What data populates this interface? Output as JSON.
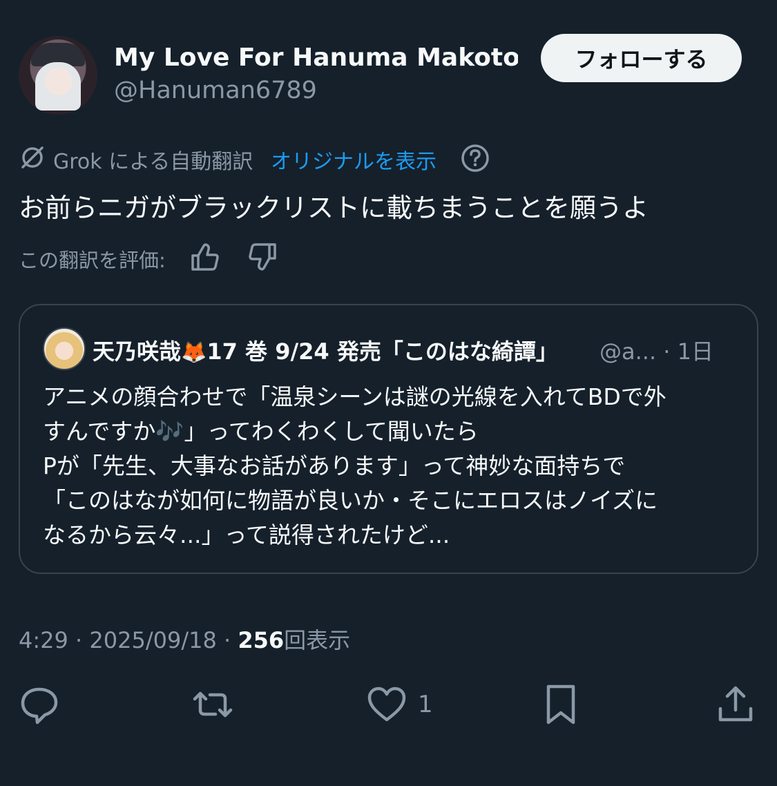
{
  "author": {
    "display_name": "My Love For Hanuma Makoto...",
    "handle": "@Hanuman6789",
    "follow_label": "フォローする"
  },
  "translation": {
    "grok_label": "Grok による自動翻訳",
    "show_original": "オリジナルを表示",
    "rate_label": "この翻訳を評価:"
  },
  "tweet": {
    "text": "お前らニガがブラックリストに載ちまうことを願うよ"
  },
  "quote": {
    "name": "天乃咲哉",
    "name_emoji": "🦊",
    "name_suffix": "17 巻 9/24 発売「このはな綺譚」",
    "meta": "@a... · 1日",
    "lines": [
      "アニメの顔合わせで「温泉シーンは謎の光線を入れてBDで外",
      "すんですか🎶」ってわくわくして聞いたら",
      "Pが「先生、大事なお話があります」って神妙な面持ちで",
      "「このはなが如何に物語が良いか・そこにエロスはノイズに",
      "なるから云々...」って説得されたけど..."
    ]
  },
  "timestamp": {
    "time_date": "4:29 · 2025/09/18 · ",
    "views_count": "256",
    "views_label": "回表示"
  },
  "actions": {
    "like_count": "1"
  },
  "colors": {
    "background": "#15202b",
    "text": "#f7f9f9",
    "secondary": "#8b98a5",
    "accent": "#1d9bf0",
    "border": "#38444d"
  }
}
